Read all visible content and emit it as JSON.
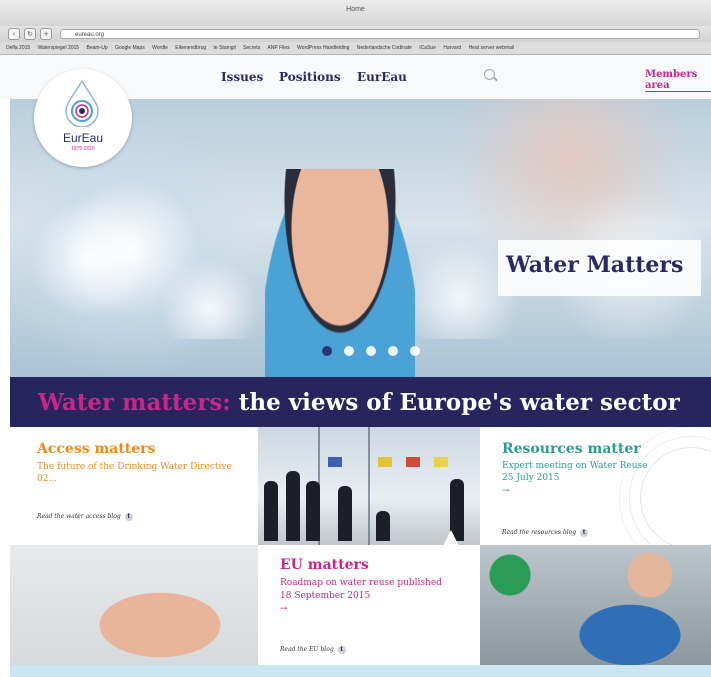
{
  "browser": {
    "title": "Home",
    "url": "eureau.org",
    "bookmarks": [
      "Delfa 2015",
      "Waterspiegel 2015",
      "Beam-Up",
      "Google Maps",
      "Wordle",
      "Eikenendbrug",
      "te Stamgil",
      "Secrets",
      "ANP Files",
      "WordPress Handleiding",
      "Nederlandsche Codinate",
      "ICaSue",
      "Harvard",
      "Heat server webmail"
    ]
  },
  "nav": {
    "items": [
      "Issues",
      "Positions",
      "EurEau"
    ],
    "members_label": "Members area"
  },
  "logo": {
    "name": "EurEau",
    "years": "1975-2015"
  },
  "hero": {
    "tagline": "Water Matters",
    "slides": 5,
    "active_slide": 1
  },
  "banner": {
    "highlight": "Water matters:",
    "rest": " the views of Europe's water sector"
  },
  "tiles": {
    "access": {
      "heading": "Access matters",
      "text": "The future of the Drinking Water Directive 02...",
      "blog": "Read the water access blog"
    },
    "resources": {
      "heading": "Resources matter",
      "text": "Expert meeting on Water Reuse",
      "date": "25 July 2015",
      "more": "→",
      "blog": "Read the resources blog"
    },
    "eu": {
      "heading": "EU matters",
      "text": "Roadmap on water reuse published",
      "date": "18 September 2015",
      "more": "→",
      "blog": "Read the EU blog"
    }
  },
  "colors": {
    "navy": "#27245e",
    "magenta": "#c8268a",
    "orange": "#f08a1c",
    "teal": "#2a9d8f"
  }
}
